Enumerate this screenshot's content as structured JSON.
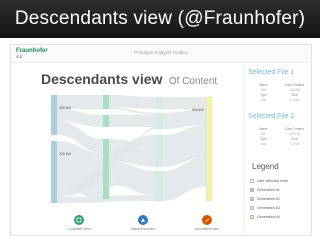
{
  "slide": {
    "title": "Descendants view (@Fraunhofer)"
  },
  "app": {
    "logo": "Fraunhofer",
    "logo_sub": "IGD",
    "title": "Prototype Analysis Toolbox"
  },
  "chart": {
    "title_bold": "Descendants view",
    "title_light": "Of Content"
  },
  "nodes": [
    {
      "id": "a",
      "label": "350 kW",
      "gen": 1
    },
    {
      "id": "b",
      "label": "320 kW",
      "gen": 1
    },
    {
      "id": "c",
      "label": "",
      "gen": 2
    },
    {
      "id": "d",
      "label": "",
      "gen": 2
    },
    {
      "id": "e",
      "label": "",
      "gen": 2
    },
    {
      "id": "f",
      "label": "",
      "gen": 3
    },
    {
      "id": "g",
      "label": "",
      "gen": 3
    },
    {
      "id": "h",
      "label": "",
      "gen": 3
    },
    {
      "id": "i",
      "label": "",
      "gen": 3
    },
    {
      "id": "j",
      "label": "660 kW",
      "gen": 4
    }
  ],
  "actions": [
    {
      "label": "Complete View",
      "color": "#2f9e6e",
      "icon": "expand-icon"
    },
    {
      "label": "Visual Evolution",
      "color": "#2b7bbd",
      "icon": "evolution-icon"
    },
    {
      "label": "Annotated view",
      "color": "#d35400",
      "icon": "annotate-icon"
    }
  ],
  "side": {
    "selected_file_1": "Selected File 1",
    "selected_file_2": "Selected File 2",
    "fields": {
      "name": "Name",
      "date": "Date Created",
      "type": "Type",
      "size": "Size"
    },
    "file1": {
      "name": "file",
      "date": "12/1/18",
      "type": "doc",
      "size": "1.2 kB"
    },
    "file2": {
      "name": "file",
      "date": "12/1/18",
      "type": "doc",
      "size": "1.2 kB"
    },
    "legend_title": "Legend",
    "legend": [
      {
        "label": "User selected node",
        "color": "#ffffff"
      },
      {
        "label": "Generation #1",
        "color": "#a9cce3"
      },
      {
        "label": "Generation #2",
        "color": "#a9dfbf"
      },
      {
        "label": "Generation #3",
        "color": "#d4efdf"
      },
      {
        "label": "Generation #4",
        "color": "#f4f1a8"
      }
    ]
  },
  "colors": {
    "gen1": "#a9cce3",
    "gen2": "#a9dfbf",
    "gen3": "#d4efdf",
    "gen4": "#f4f1a8",
    "link": "#dfe6e9"
  }
}
